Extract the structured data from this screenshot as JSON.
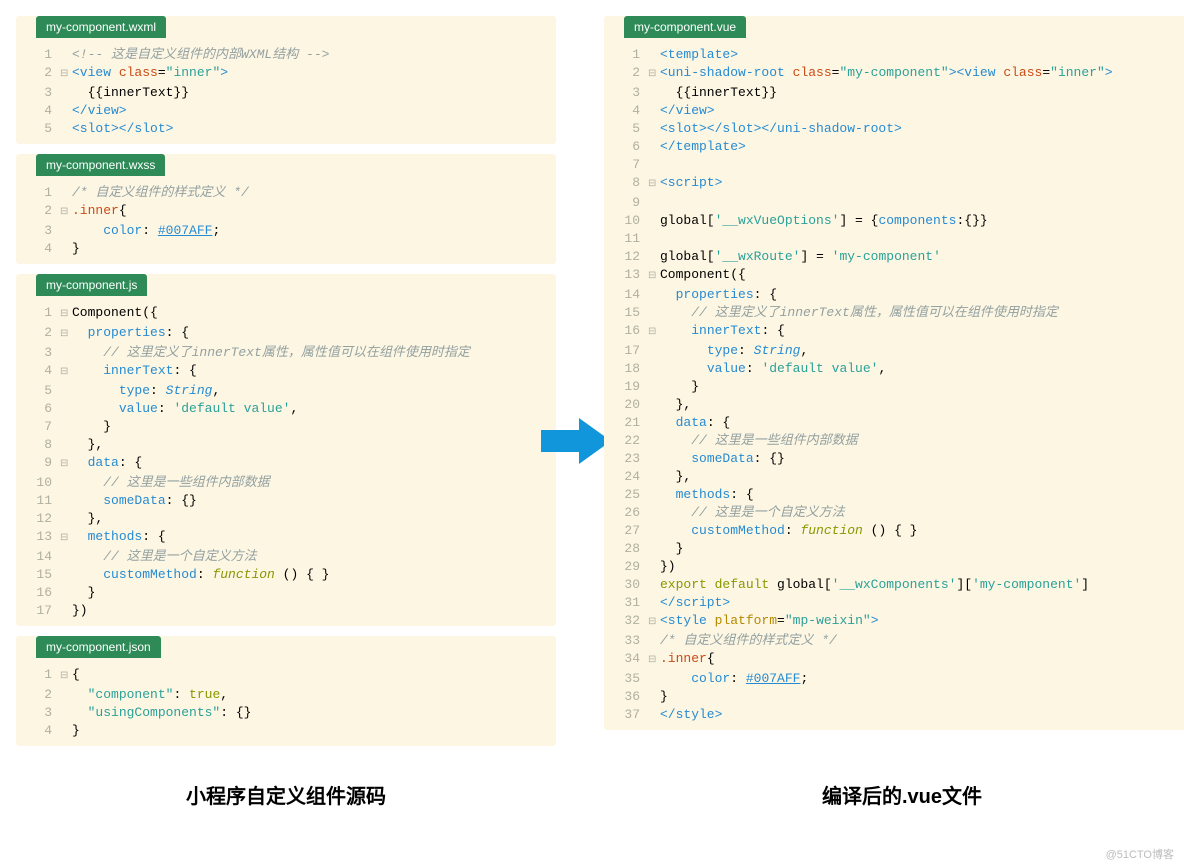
{
  "captions": {
    "left": "小程序自定义组件源码",
    "right": "编译后的.vue文件"
  },
  "watermark": "@51CTO博客",
  "panels": {
    "wxml": {
      "tab": "my-component.wxml",
      "lines": [
        {
          "n": "1",
          "f": "",
          "html": "<span class='c-comment'>&lt;!-- 这是自定义组件的内部WXML结构 --&gt;</span>"
        },
        {
          "n": "2",
          "f": "⊟",
          "html": "<span class='c-tag'>&lt;view</span> <span class='c-class'>class</span>=<span class='c-str'>\"inner\"</span><span class='c-tag'>&gt;</span>"
        },
        {
          "n": "3",
          "f": "",
          "html": "  {{innerText}}"
        },
        {
          "n": "4",
          "f": "",
          "html": "<span class='c-tag'>&lt;/view&gt;</span>"
        },
        {
          "n": "5",
          "f": "",
          "html": "<span class='c-tag'>&lt;slot&gt;&lt;/slot&gt;</span>"
        }
      ]
    },
    "wxss": {
      "tab": "my-component.wxss",
      "lines": [
        {
          "n": "1",
          "f": "",
          "html": "<span class='c-comment'>/* 自定义组件的样式定义 */</span>"
        },
        {
          "n": "2",
          "f": "⊟",
          "html": "<span class='c-class'>.inner</span>{"
        },
        {
          "n": "3",
          "f": "",
          "html": "    <span class='c-prop'>color</span>: <span class='c-link'>#007AFF</span>;"
        },
        {
          "n": "4",
          "f": "",
          "html": "}"
        }
      ]
    },
    "js": {
      "tab": "my-component.js",
      "lines": [
        {
          "n": "1",
          "f": "⊟",
          "html": "Component({"
        },
        {
          "n": "2",
          "f": "⊟",
          "html": "  <span class='c-prop'>properties</span>: {"
        },
        {
          "n": "3",
          "f": "",
          "html": "    <span class='c-comment'>// 这里定义了innerText属性，属性值可以在组件使用时指定</span>"
        },
        {
          "n": "4",
          "f": "⊟",
          "html": "    <span class='c-prop'>innerText</span>: {"
        },
        {
          "n": "5",
          "f": "",
          "html": "      <span class='c-prop'>type</span>: <span class='c-type'>String</span>,"
        },
        {
          "n": "6",
          "f": "",
          "html": "      <span class='c-prop'>value</span>: <span class='c-str'>'default value'</span>,"
        },
        {
          "n": "7",
          "f": "",
          "html": "    }"
        },
        {
          "n": "8",
          "f": "",
          "html": "  },"
        },
        {
          "n": "9",
          "f": "⊟",
          "html": "  <span class='c-prop'>data</span>: {"
        },
        {
          "n": "10",
          "f": "",
          "html": "    <span class='c-comment'>// 这里是一些组件内部数据</span>"
        },
        {
          "n": "11",
          "f": "",
          "html": "    <span class='c-prop'>someData</span>: {}"
        },
        {
          "n": "12",
          "f": "",
          "html": "  },"
        },
        {
          "n": "13",
          "f": "⊟",
          "html": "  <span class='c-prop'>methods</span>: {"
        },
        {
          "n": "14",
          "f": "",
          "html": "    <span class='c-comment'>// 这里是一个自定义方法</span>"
        },
        {
          "n": "15",
          "f": "",
          "html": "    <span class='c-prop'>customMethod</span>: <span class='c-keyword c-func'>function</span> () { }"
        },
        {
          "n": "16",
          "f": "",
          "html": "  }"
        },
        {
          "n": "17",
          "f": "",
          "html": "})"
        }
      ]
    },
    "json": {
      "tab": "my-component.json",
      "lines": [
        {
          "n": "1",
          "f": "⊟",
          "html": "{"
        },
        {
          "n": "2",
          "f": "",
          "html": "  <span class='c-str'>\"component\"</span>: <span class='c-keyword'>true</span>,"
        },
        {
          "n": "3",
          "f": "",
          "html": "  <span class='c-str'>\"usingComponents\"</span>: {}"
        },
        {
          "n": "4",
          "f": "",
          "html": "}"
        }
      ]
    },
    "vue": {
      "tab": "my-component.vue",
      "lines": [
        {
          "n": "1",
          "f": "",
          "html": "<span class='c-tag'>&lt;template&gt;</span>"
        },
        {
          "n": "2",
          "f": "⊟",
          "html": "<span class='c-tag'>&lt;uni-shadow-root</span> <span class='c-class'>class</span>=<span class='c-str'>\"my-component\"</span><span class='c-tag'>&gt;&lt;view</span> <span class='c-class'>class</span>=<span class='c-str'>\"inner\"</span><span class='c-tag'>&gt;</span>"
        },
        {
          "n": "3",
          "f": "",
          "html": "  {{innerText}}"
        },
        {
          "n": "4",
          "f": "",
          "html": "<span class='c-tag'>&lt;/view&gt;</span>"
        },
        {
          "n": "5",
          "f": "",
          "html": "<span class='c-tag'>&lt;slot&gt;&lt;/slot&gt;&lt;/uni-shadow-root&gt;</span>"
        },
        {
          "n": "6",
          "f": "",
          "html": "<span class='c-tag'>&lt;/template&gt;</span>"
        },
        {
          "n": "7",
          "f": "",
          "html": ""
        },
        {
          "n": "8",
          "f": "⊟",
          "html": "<span class='c-tag'>&lt;script&gt;</span>"
        },
        {
          "n": "9",
          "f": "",
          "html": ""
        },
        {
          "n": "10",
          "f": "",
          "html": "global[<span class='c-str'>'__wxVueOptions'</span>] = {<span class='c-prop'>components</span>:{}}"
        },
        {
          "n": "11",
          "f": "",
          "html": ""
        },
        {
          "n": "12",
          "f": "",
          "html": "global[<span class='c-str'>'__wxRoute'</span>] = <span class='c-str'>'my-component'</span>"
        },
        {
          "n": "13",
          "f": "⊟",
          "html": "Component({"
        },
        {
          "n": "14",
          "f": "",
          "html": "  <span class='c-prop'>properties</span>: {"
        },
        {
          "n": "15",
          "f": "",
          "html": "    <span class='c-comment'>// 这里定义了innerText属性，属性值可以在组件使用时指定</span>"
        },
        {
          "n": "16",
          "f": "⊟",
          "html": "    <span class='c-prop'>innerText</span>: {"
        },
        {
          "n": "17",
          "f": "",
          "html": "      <span class='c-prop'>type</span>: <span class='c-type'>String</span>,"
        },
        {
          "n": "18",
          "f": "",
          "html": "      <span class='c-prop'>value</span>: <span class='c-str'>'default value'</span>,"
        },
        {
          "n": "19",
          "f": "",
          "html": "    }"
        },
        {
          "n": "20",
          "f": "",
          "html": "  },"
        },
        {
          "n": "21",
          "f": "",
          "html": "  <span class='c-prop'>data</span>: {"
        },
        {
          "n": "22",
          "f": "",
          "html": "    <span class='c-comment'>// 这里是一些组件内部数据</span>"
        },
        {
          "n": "23",
          "f": "",
          "html": "    <span class='c-prop'>someData</span>: {}"
        },
        {
          "n": "24",
          "f": "",
          "html": "  },"
        },
        {
          "n": "25",
          "f": "",
          "html": "  <span class='c-prop'>methods</span>: {"
        },
        {
          "n": "26",
          "f": "",
          "html": "    <span class='c-comment'>// 这里是一个自定义方法</span>"
        },
        {
          "n": "27",
          "f": "",
          "html": "    <span class='c-prop'>customMethod</span>: <span class='c-keyword c-func'>function</span> () { }"
        },
        {
          "n": "28",
          "f": "",
          "html": "  }"
        },
        {
          "n": "29",
          "f": "",
          "html": "})"
        },
        {
          "n": "30",
          "f": "",
          "html": "<span class='c-keyword'>export default</span> global[<span class='c-str'>'__wxComponents'</span>][<span class='c-str'>'my-component'</span>]"
        },
        {
          "n": "31",
          "f": "",
          "html": "<span class='c-tag'>&lt;/script&gt;</span>"
        },
        {
          "n": "32",
          "f": "⊟",
          "html": "<span class='c-tag'>&lt;style</span> <span class='c-attr'>platform</span>=<span class='c-str'>\"mp-weixin\"</span><span class='c-tag'>&gt;</span>"
        },
        {
          "n": "33",
          "f": "",
          "html": "<span class='c-comment'>/* 自定义组件的样式定义 */</span>"
        },
        {
          "n": "34",
          "f": "⊟",
          "html": "<span class='c-class'>.inner</span>{"
        },
        {
          "n": "35",
          "f": "",
          "html": "    <span class='c-prop'>color</span>: <span class='c-link'>#007AFF</span>;"
        },
        {
          "n": "36",
          "f": "",
          "html": "}"
        },
        {
          "n": "37",
          "f": "",
          "html": "<span class='c-tag'>&lt;/style&gt;</span>"
        }
      ]
    }
  }
}
